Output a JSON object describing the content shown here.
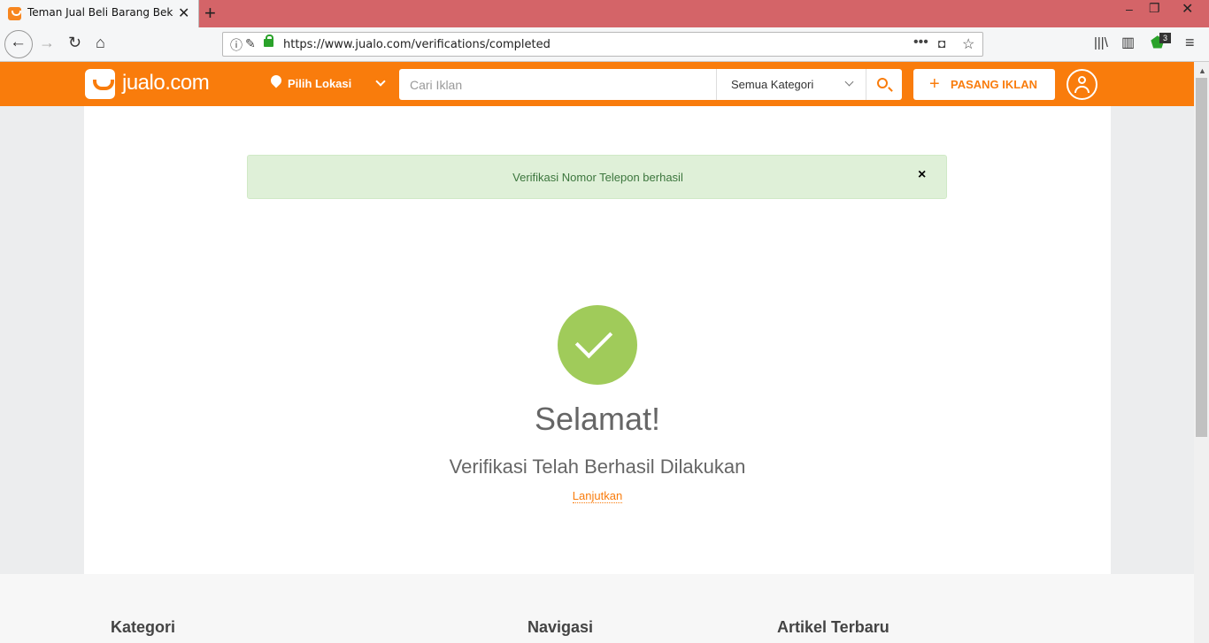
{
  "browser": {
    "tab_title": "Teman Jual Beli Barang Bekas di",
    "url": "https://www.jualo.com/verifications/completed",
    "extension_badge": "3"
  },
  "header": {
    "logo_text": "jualo.com",
    "location_label": "Pilih Lokasi",
    "search_placeholder": "Cari Iklan",
    "category_label": "Semua Kategori",
    "post_label": "PASANG IKLAN"
  },
  "main": {
    "alert_text": "Verifikasi Nomor Telepon berhasil",
    "alert_close": "×",
    "congrats": "Selamat!",
    "subtitle": "Verifikasi Telah Berhasil Dilakukan",
    "continue_link": "Lanjutkan"
  },
  "footer": {
    "col1": "Kategori",
    "col2": "Navigasi",
    "col3": "Artikel Terbaru"
  },
  "colors": {
    "brand": "#f97c0c",
    "success": "#a0cb5a",
    "alert_bg": "#dff0d8"
  }
}
